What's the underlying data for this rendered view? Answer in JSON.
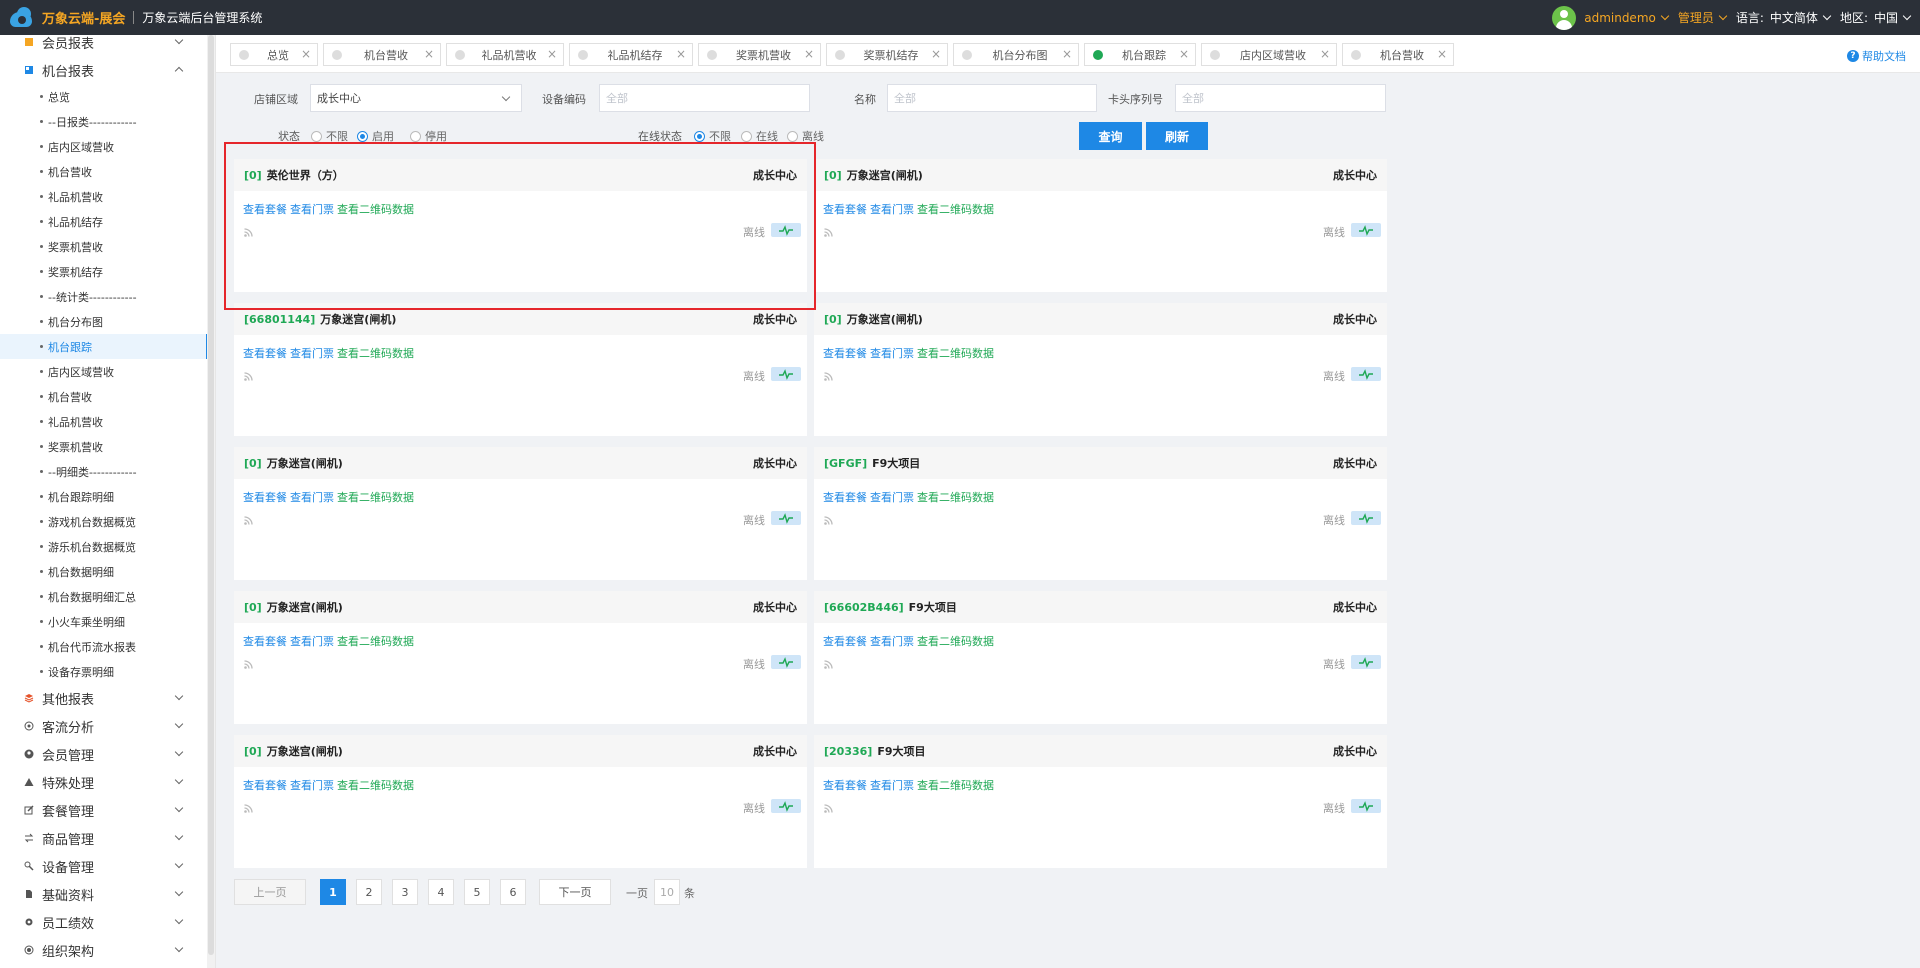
{
  "header": {
    "brand": "万象云端-展会",
    "subtitle": "万象云端后台管理系统",
    "user": "admindemo",
    "role": "管理员",
    "language_label": "语言:",
    "language_value": "中文简体",
    "region_label": "地区:",
    "region_value": "中国",
    "accent_color": "#f5a623",
    "bg_color": "#2b3038"
  },
  "sidebar": {
    "groups_top": [
      {
        "label": "会员报表",
        "expanded": false
      },
      {
        "label": "机台报表",
        "expanded": true
      }
    ],
    "sub_items": [
      "总览",
      "--日报类------------",
      "店内区域营收",
      "机台营收",
      "礼品机营收",
      "礼品机结存",
      "奖票机营收",
      "奖票机结存",
      "--统计类------------",
      "机台分布图",
      "机台跟踪",
      "店内区域营收",
      "机台营收",
      "礼品机营收",
      "奖票机营收",
      "--明细类------------",
      "机台跟踪明细",
      "游戏机台数据概览",
      "游乐机台数据概览",
      "机台数据明细",
      "机台数据明细汇总",
      "小火车乘坐明细",
      "机台代币流水报表",
      "设备存票明细"
    ],
    "active_sub_index": 10,
    "groups_bottom": [
      {
        "label": "其他报表",
        "icon": "stack-icon"
      },
      {
        "label": "客流分析",
        "icon": "target-icon"
      },
      {
        "label": "会员管理",
        "icon": "user-icon"
      },
      {
        "label": "特殊处理",
        "icon": "warning-icon"
      },
      {
        "label": "套餐管理",
        "icon": "edit-icon"
      },
      {
        "label": "商品管理",
        "icon": "swap-icon"
      },
      {
        "label": "设备管理",
        "icon": "tool-icon"
      },
      {
        "label": "基础资料",
        "icon": "file-icon"
      },
      {
        "label": "员工绩效",
        "icon": "gear-icon"
      },
      {
        "label": "组织架构",
        "icon": "org-icon"
      }
    ]
  },
  "tabs": [
    {
      "label": "总览",
      "active": false
    },
    {
      "label": "机台营收",
      "active": false
    },
    {
      "label": "礼品机营收",
      "active": false
    },
    {
      "label": "礼品机结存",
      "active": false
    },
    {
      "label": "奖票机营收",
      "active": false
    },
    {
      "label": "奖票机结存",
      "active": false
    },
    {
      "label": "机台分布图",
      "active": false
    },
    {
      "label": "机台跟踪",
      "active": true
    },
    {
      "label": "店内区域营收",
      "active": false
    },
    {
      "label": "机台营收",
      "active": false
    }
  ],
  "help_label": "帮助文档",
  "filters": {
    "store_area_label": "店铺区域",
    "store_area_value": "成长中心",
    "device_code_label": "设备编码",
    "device_code_placeholder": "全部",
    "name_label": "名称",
    "name_placeholder": "全部",
    "card_serial_label": "卡头序列号",
    "card_serial_placeholder": "全部",
    "status_label": "状态",
    "status_options": [
      "不限",
      "启用",
      "停用"
    ],
    "status_selected": "启用",
    "online_label": "在线状态",
    "online_options": [
      "不限",
      "在线",
      "离线"
    ],
    "online_selected": "不限",
    "query_button": "查询",
    "refresh_button": "刷新"
  },
  "card_links": {
    "package": "查看套餐",
    "ticket": "查看门票",
    "qrcode": "查看二维码数据"
  },
  "cards": [
    {
      "code": "[0]",
      "name": "英伦世界（方）",
      "region": "成长中心",
      "status": "离线"
    },
    {
      "code": "[0]",
      "name": "万象迷宫(闸机)",
      "region": "成长中心",
      "status": "离线"
    },
    {
      "code": "[66801144]",
      "name": "万象迷宫(闸机)",
      "region": "成长中心",
      "status": "离线"
    },
    {
      "code": "[0]",
      "name": "万象迷宫(闸机)",
      "region": "成长中心",
      "status": "离线"
    },
    {
      "code": "[0]",
      "name": "万象迷宫(闸机)",
      "region": "成长中心",
      "status": "离线"
    },
    {
      "code": "[GFGF]",
      "name": "F9大项目",
      "region": "成长中心",
      "status": "离线"
    },
    {
      "code": "[0]",
      "name": "万象迷宫(闸机)",
      "region": "成长中心",
      "status": "离线"
    },
    {
      "code": "[66602B446]",
      "name": "F9大项目",
      "region": "成长中心",
      "status": "离线"
    },
    {
      "code": "[0]",
      "name": "万象迷宫(闸机)",
      "region": "成长中心",
      "status": "离线"
    },
    {
      "code": "[20336]",
      "name": "F9大项目",
      "region": "成长中心",
      "status": "离线"
    }
  ],
  "pager": {
    "prev": "上一页",
    "pages": [
      "1",
      "2",
      "3",
      "4",
      "5",
      "6"
    ],
    "current": "1",
    "next": "下一页",
    "per_page_prefix": "一页",
    "per_page_value": "10",
    "per_page_suffix": "条"
  }
}
